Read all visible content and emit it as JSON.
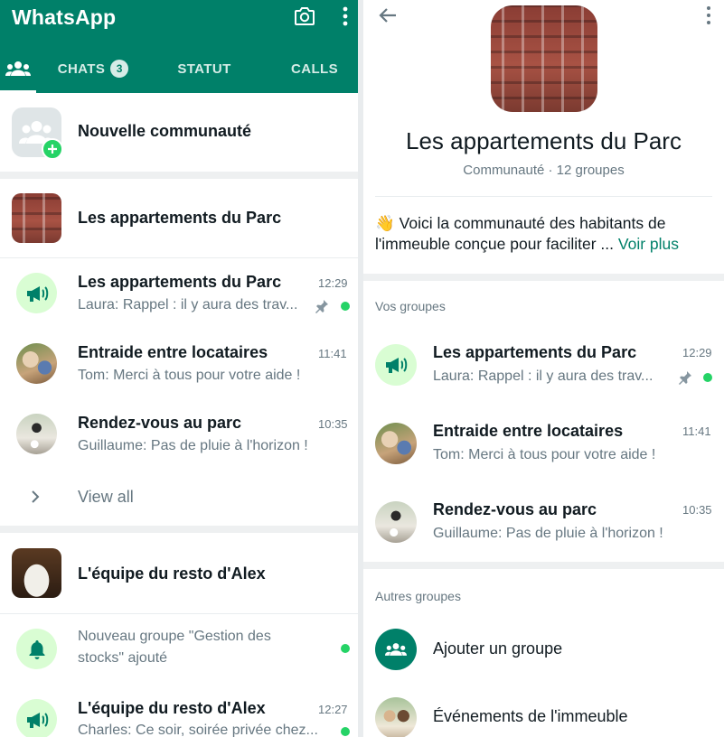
{
  "left": {
    "app_title": "WhatsApp",
    "header_icons": [
      "camera-icon",
      "more-vert-icon"
    ],
    "tabs": {
      "community_icon": "groups-icon",
      "chats_label": "CHATS",
      "chats_badge": "3",
      "status_label": "STATUT",
      "calls_label": "CALLS"
    },
    "new_community_label": "Nouvelle communauté",
    "community1": {
      "name": "Les appartements du Parc",
      "chats": [
        {
          "name": "Les appartements du Parc",
          "time": "12:29",
          "preview": "Laura: Rappel :  il y aura des trav...",
          "pinned": true,
          "unread": true
        },
        {
          "name": "Entraide entre locataires",
          "time": "11:41",
          "preview": "Tom: Merci à tous pour votre aide !"
        },
        {
          "name": "Rendez-vous au parc",
          "time": "10:35",
          "preview": "Guillaume: Pas de pluie à l'horizon !"
        }
      ],
      "view_all_label": "View all"
    },
    "community2": {
      "name": "L'équipe du resto d'Alex",
      "notice_line1": "Nouveau groupe \"Gestion des",
      "notice_line2": "stocks\" ajouté",
      "chat": {
        "name": "L'équipe du resto d'Alex",
        "time": "12:27",
        "preview": "Charles: Ce soir, soirée privée chez..."
      }
    }
  },
  "right": {
    "title": "Les appartements du Parc",
    "subtitle": "Communauté · 12 groupes",
    "desc_emoji": "👋",
    "desc_line1": "Voici la communauté des habitants de",
    "desc_line2": "l'immeuble conçue pour faciliter ...",
    "more_label": "Voir plus",
    "your_groups_label": "Vos groupes",
    "groups": [
      {
        "name": "Les appartements du Parc",
        "time": "12:29",
        "preview": "Laura: Rappel :  il y aura des trav...",
        "pinned": true,
        "unread": true
      },
      {
        "name": "Entraide entre locataires",
        "time": "11:41",
        "preview": "Tom: Merci à tous pour votre aide !"
      },
      {
        "name": "Rendez-vous au parc",
        "time": "10:35",
        "preview": "Guillaume: Pas de pluie à l'horizon !"
      }
    ],
    "other_groups_label": "Autres groupes",
    "add_group_label": "Ajouter un groupe",
    "event_group_label": "Événements de l'immeuble"
  },
  "colors": {
    "brand": "#008069",
    "unread": "#25d366",
    "announcement_bg": "#d9fdd3"
  }
}
